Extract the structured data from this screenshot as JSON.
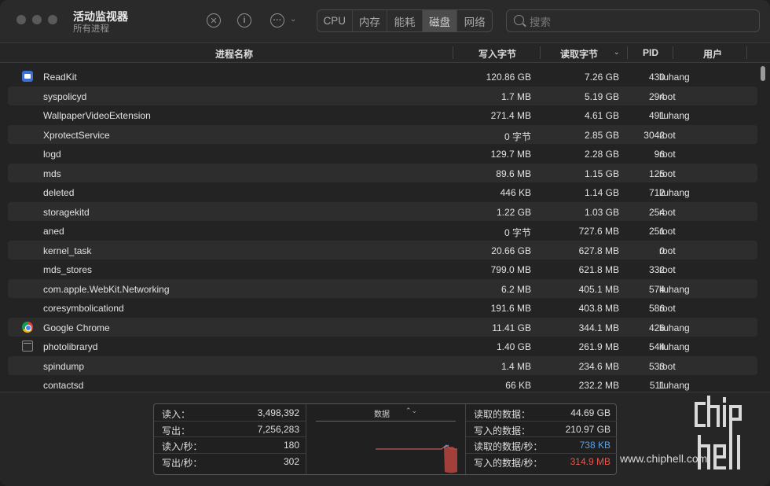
{
  "window": {
    "title": "活动监视器",
    "subtitle": "所有进程"
  },
  "toolbar": {
    "stop_icon": "xmark-circle-icon",
    "info_icon": "info-circle-icon",
    "more_icon": "ellipsis-circle-icon",
    "tabs": [
      {
        "label": "CPU",
        "active": false
      },
      {
        "label": "内存",
        "active": false
      },
      {
        "label": "能耗",
        "active": false
      },
      {
        "label": "磁盘",
        "active": true
      },
      {
        "label": "网络",
        "active": false
      }
    ],
    "search_placeholder": "搜索"
  },
  "table": {
    "headers": {
      "name": "进程名称",
      "write": "写入字节",
      "read": "读取字节",
      "pid": "PID",
      "user": "用户"
    },
    "rows": [
      {
        "icon": "readkit-icon",
        "name": "ReadKit",
        "write": "120.86 GB",
        "read": "7.26 GB",
        "pid": "430",
        "user": "liuhang"
      },
      {
        "icon": "",
        "name": "syspolicyd",
        "write": "1.7 MB",
        "read": "5.19 GB",
        "pid": "294",
        "user": "root"
      },
      {
        "icon": "",
        "name": "WallpaperVideoExtension",
        "write": "271.4 MB",
        "read": "4.61 GB",
        "pid": "491",
        "user": "liuhang"
      },
      {
        "icon": "",
        "name": "XprotectService",
        "write": "0 字节",
        "read": "2.85 GB",
        "pid": "3042",
        "user": "root"
      },
      {
        "icon": "",
        "name": "logd",
        "write": "129.7 MB",
        "read": "2.28 GB",
        "pid": "96",
        "user": "root"
      },
      {
        "icon": "",
        "name": "mds",
        "write": "89.6 MB",
        "read": "1.15 GB",
        "pid": "125",
        "user": "root"
      },
      {
        "icon": "",
        "name": "deleted",
        "write": "446 KB",
        "read": "1.14 GB",
        "pid": "712",
        "user": "liuhang"
      },
      {
        "icon": "",
        "name": "storagekitd",
        "write": "1.22 GB",
        "read": "1.03 GB",
        "pid": "254",
        "user": "root"
      },
      {
        "icon": "",
        "name": "aned",
        "write": "0 字节",
        "read": "727.6 MB",
        "pid": "251",
        "user": "root"
      },
      {
        "icon": "",
        "name": "kernel_task",
        "write": "20.66 GB",
        "read": "627.8 MB",
        "pid": "0",
        "user": "root"
      },
      {
        "icon": "",
        "name": "mds_stores",
        "write": "799.0 MB",
        "read": "621.8 MB",
        "pid": "332",
        "user": "root"
      },
      {
        "icon": "",
        "name": "com.apple.WebKit.Networking",
        "write": "6.2 MB",
        "read": "405.1 MB",
        "pid": "574",
        "user": "liuhang"
      },
      {
        "icon": "",
        "name": "coresymbolicationd",
        "write": "191.6 MB",
        "read": "403.8 MB",
        "pid": "586",
        "user": "root"
      },
      {
        "icon": "chrome-icon",
        "name": "Google Chrome",
        "write": "11.41 GB",
        "read": "344.1 MB",
        "pid": "426",
        "user": "liuhang"
      },
      {
        "icon": "photo-library-icon",
        "name": "photolibraryd",
        "write": "1.40 GB",
        "read": "261.9 MB",
        "pid": "544",
        "user": "liuhang"
      },
      {
        "icon": "",
        "name": "spindump",
        "write": "1.4 MB",
        "read": "234.6 MB",
        "pid": "533",
        "user": "root"
      },
      {
        "icon": "",
        "name": "contactsd",
        "write": "66 KB",
        "read": "232.2 MB",
        "pid": "511",
        "user": "liuhang"
      }
    ]
  },
  "summary": {
    "left": [
      {
        "label": "读入：",
        "value": "3,498,392"
      },
      {
        "label": "写出：",
        "value": "7,256,283"
      },
      {
        "label": "读入/秒：",
        "value": "180"
      },
      {
        "label": "写出/秒：",
        "value": "302"
      }
    ],
    "graph_label": "数据",
    "right": [
      {
        "label": "读取的数据：",
        "value": "44.69 GB",
        "color": ""
      },
      {
        "label": "写入的数据：",
        "value": "210.97 GB",
        "color": ""
      },
      {
        "label": "读取的数据/秒：",
        "value": "738 KB",
        "color": "#5aa2e6"
      },
      {
        "label": "写入的数据/秒：",
        "value": "314.9 MB",
        "color": "#e8564c"
      }
    ]
  },
  "watermark": {
    "url": "www.chiphell.com",
    "logo_top": "chip",
    "logo_bottom": "hell"
  }
}
